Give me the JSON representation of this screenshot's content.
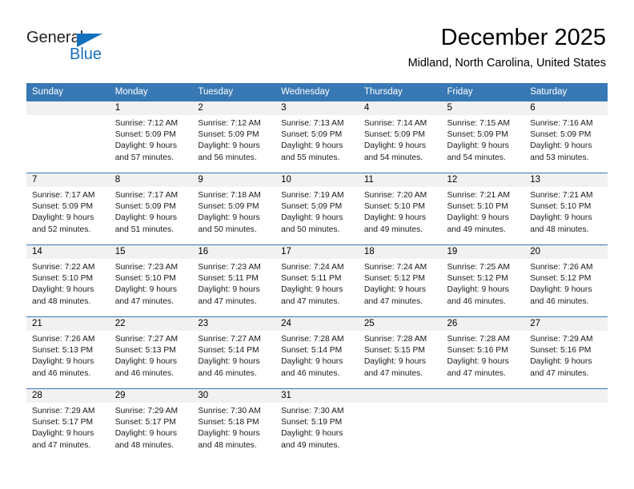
{
  "brand": {
    "name_part1": "General",
    "name_part2": "Blue",
    "logo_icon": "triangle-flag-icon",
    "accent_color": "#1570bc"
  },
  "header": {
    "title": "December 2025",
    "subtitle": "Midland, North Carolina, United States"
  },
  "calendar": {
    "header_bg_color": "#3878b4",
    "daynum_bg_color": "#f1f1f1",
    "weekday_headers": [
      "Sunday",
      "Monday",
      "Tuesday",
      "Wednesday",
      "Thursday",
      "Friday",
      "Saturday"
    ],
    "weeks": [
      [
        {
          "day": "",
          "empty": true,
          "sunrise": "",
          "sunset": "",
          "daylight_line1": "",
          "daylight_line2": ""
        },
        {
          "day": "1",
          "empty": false,
          "sunrise": "Sunrise: 7:12 AM",
          "sunset": "Sunset: 5:09 PM",
          "daylight_line1": "Daylight: 9 hours",
          "daylight_line2": "and 57 minutes."
        },
        {
          "day": "2",
          "empty": false,
          "sunrise": "Sunrise: 7:12 AM",
          "sunset": "Sunset: 5:09 PM",
          "daylight_line1": "Daylight: 9 hours",
          "daylight_line2": "and 56 minutes."
        },
        {
          "day": "3",
          "empty": false,
          "sunrise": "Sunrise: 7:13 AM",
          "sunset": "Sunset: 5:09 PM",
          "daylight_line1": "Daylight: 9 hours",
          "daylight_line2": "and 55 minutes."
        },
        {
          "day": "4",
          "empty": false,
          "sunrise": "Sunrise: 7:14 AM",
          "sunset": "Sunset: 5:09 PM",
          "daylight_line1": "Daylight: 9 hours",
          "daylight_line2": "and 54 minutes."
        },
        {
          "day": "5",
          "empty": false,
          "sunrise": "Sunrise: 7:15 AM",
          "sunset": "Sunset: 5:09 PM",
          "daylight_line1": "Daylight: 9 hours",
          "daylight_line2": "and 54 minutes."
        },
        {
          "day": "6",
          "empty": false,
          "sunrise": "Sunrise: 7:16 AM",
          "sunset": "Sunset: 5:09 PM",
          "daylight_line1": "Daylight: 9 hours",
          "daylight_line2": "and 53 minutes."
        }
      ],
      [
        {
          "day": "7",
          "empty": false,
          "sunrise": "Sunrise: 7:17 AM",
          "sunset": "Sunset: 5:09 PM",
          "daylight_line1": "Daylight: 9 hours",
          "daylight_line2": "and 52 minutes."
        },
        {
          "day": "8",
          "empty": false,
          "sunrise": "Sunrise: 7:17 AM",
          "sunset": "Sunset: 5:09 PM",
          "daylight_line1": "Daylight: 9 hours",
          "daylight_line2": "and 51 minutes."
        },
        {
          "day": "9",
          "empty": false,
          "sunrise": "Sunrise: 7:18 AM",
          "sunset": "Sunset: 5:09 PM",
          "daylight_line1": "Daylight: 9 hours",
          "daylight_line2": "and 50 minutes."
        },
        {
          "day": "10",
          "empty": false,
          "sunrise": "Sunrise: 7:19 AM",
          "sunset": "Sunset: 5:09 PM",
          "daylight_line1": "Daylight: 9 hours",
          "daylight_line2": "and 50 minutes."
        },
        {
          "day": "11",
          "empty": false,
          "sunrise": "Sunrise: 7:20 AM",
          "sunset": "Sunset: 5:10 PM",
          "daylight_line1": "Daylight: 9 hours",
          "daylight_line2": "and 49 minutes."
        },
        {
          "day": "12",
          "empty": false,
          "sunrise": "Sunrise: 7:21 AM",
          "sunset": "Sunset: 5:10 PM",
          "daylight_line1": "Daylight: 9 hours",
          "daylight_line2": "and 49 minutes."
        },
        {
          "day": "13",
          "empty": false,
          "sunrise": "Sunrise: 7:21 AM",
          "sunset": "Sunset: 5:10 PM",
          "daylight_line1": "Daylight: 9 hours",
          "daylight_line2": "and 48 minutes."
        }
      ],
      [
        {
          "day": "14",
          "empty": false,
          "sunrise": "Sunrise: 7:22 AM",
          "sunset": "Sunset: 5:10 PM",
          "daylight_line1": "Daylight: 9 hours",
          "daylight_line2": "and 48 minutes."
        },
        {
          "day": "15",
          "empty": false,
          "sunrise": "Sunrise: 7:23 AM",
          "sunset": "Sunset: 5:10 PM",
          "daylight_line1": "Daylight: 9 hours",
          "daylight_line2": "and 47 minutes."
        },
        {
          "day": "16",
          "empty": false,
          "sunrise": "Sunrise: 7:23 AM",
          "sunset": "Sunset: 5:11 PM",
          "daylight_line1": "Daylight: 9 hours",
          "daylight_line2": "and 47 minutes."
        },
        {
          "day": "17",
          "empty": false,
          "sunrise": "Sunrise: 7:24 AM",
          "sunset": "Sunset: 5:11 PM",
          "daylight_line1": "Daylight: 9 hours",
          "daylight_line2": "and 47 minutes."
        },
        {
          "day": "18",
          "empty": false,
          "sunrise": "Sunrise: 7:24 AM",
          "sunset": "Sunset: 5:12 PM",
          "daylight_line1": "Daylight: 9 hours",
          "daylight_line2": "and 47 minutes."
        },
        {
          "day": "19",
          "empty": false,
          "sunrise": "Sunrise: 7:25 AM",
          "sunset": "Sunset: 5:12 PM",
          "daylight_line1": "Daylight: 9 hours",
          "daylight_line2": "and 46 minutes."
        },
        {
          "day": "20",
          "empty": false,
          "sunrise": "Sunrise: 7:26 AM",
          "sunset": "Sunset: 5:12 PM",
          "daylight_line1": "Daylight: 9 hours",
          "daylight_line2": "and 46 minutes."
        }
      ],
      [
        {
          "day": "21",
          "empty": false,
          "sunrise": "Sunrise: 7:26 AM",
          "sunset": "Sunset: 5:13 PM",
          "daylight_line1": "Daylight: 9 hours",
          "daylight_line2": "and 46 minutes."
        },
        {
          "day": "22",
          "empty": false,
          "sunrise": "Sunrise: 7:27 AM",
          "sunset": "Sunset: 5:13 PM",
          "daylight_line1": "Daylight: 9 hours",
          "daylight_line2": "and 46 minutes."
        },
        {
          "day": "23",
          "empty": false,
          "sunrise": "Sunrise: 7:27 AM",
          "sunset": "Sunset: 5:14 PM",
          "daylight_line1": "Daylight: 9 hours",
          "daylight_line2": "and 46 minutes."
        },
        {
          "day": "24",
          "empty": false,
          "sunrise": "Sunrise: 7:28 AM",
          "sunset": "Sunset: 5:14 PM",
          "daylight_line1": "Daylight: 9 hours",
          "daylight_line2": "and 46 minutes."
        },
        {
          "day": "25",
          "empty": false,
          "sunrise": "Sunrise: 7:28 AM",
          "sunset": "Sunset: 5:15 PM",
          "daylight_line1": "Daylight: 9 hours",
          "daylight_line2": "and 47 minutes."
        },
        {
          "day": "26",
          "empty": false,
          "sunrise": "Sunrise: 7:28 AM",
          "sunset": "Sunset: 5:16 PM",
          "daylight_line1": "Daylight: 9 hours",
          "daylight_line2": "and 47 minutes."
        },
        {
          "day": "27",
          "empty": false,
          "sunrise": "Sunrise: 7:29 AM",
          "sunset": "Sunset: 5:16 PM",
          "daylight_line1": "Daylight: 9 hours",
          "daylight_line2": "and 47 minutes."
        }
      ],
      [
        {
          "day": "28",
          "empty": false,
          "sunrise": "Sunrise: 7:29 AM",
          "sunset": "Sunset: 5:17 PM",
          "daylight_line1": "Daylight: 9 hours",
          "daylight_line2": "and 47 minutes."
        },
        {
          "day": "29",
          "empty": false,
          "sunrise": "Sunrise: 7:29 AM",
          "sunset": "Sunset: 5:17 PM",
          "daylight_line1": "Daylight: 9 hours",
          "daylight_line2": "and 48 minutes."
        },
        {
          "day": "30",
          "empty": false,
          "sunrise": "Sunrise: 7:30 AM",
          "sunset": "Sunset: 5:18 PM",
          "daylight_line1": "Daylight: 9 hours",
          "daylight_line2": "and 48 minutes."
        },
        {
          "day": "31",
          "empty": false,
          "sunrise": "Sunrise: 7:30 AM",
          "sunset": "Sunset: 5:19 PM",
          "daylight_line1": "Daylight: 9 hours",
          "daylight_line2": "and 49 minutes."
        },
        {
          "day": "",
          "empty": true,
          "sunrise": "",
          "sunset": "",
          "daylight_line1": "",
          "daylight_line2": ""
        },
        {
          "day": "",
          "empty": true,
          "sunrise": "",
          "sunset": "",
          "daylight_line1": "",
          "daylight_line2": ""
        },
        {
          "day": "",
          "empty": true,
          "sunrise": "",
          "sunset": "",
          "daylight_line1": "",
          "daylight_line2": ""
        }
      ]
    ]
  }
}
